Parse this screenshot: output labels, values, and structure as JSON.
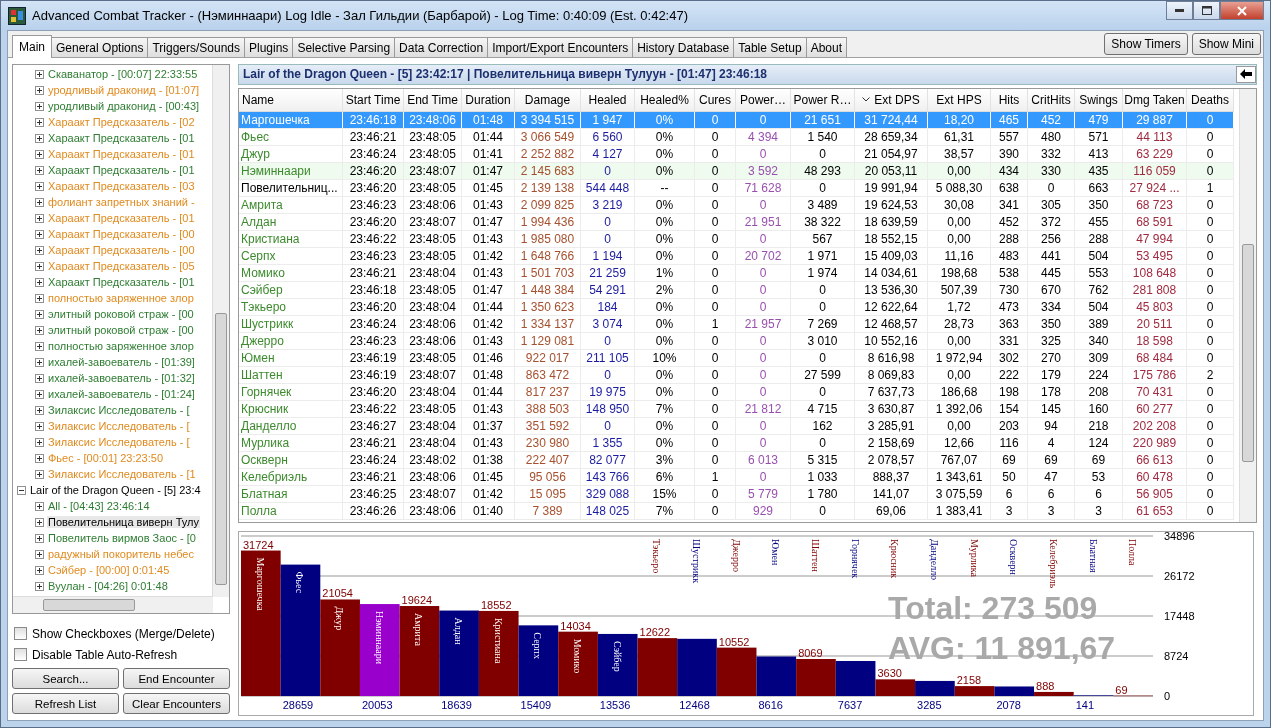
{
  "window": {
    "title": "Advanced Combat Tracker - (Нэминнаари) Log Idle - Зал Гильдии (Барбарой) - Log Time: 0:40:09 (Est. 0:42:47)"
  },
  "tabs": [
    {
      "label": "Main",
      "selected": true
    },
    {
      "label": "General Options",
      "selected": false
    },
    {
      "label": "Triggers/Sounds",
      "selected": false
    },
    {
      "label": "Plugins",
      "selected": false
    },
    {
      "label": "Selective Parsing",
      "selected": false
    },
    {
      "label": "Data Correction",
      "selected": false
    },
    {
      "label": "Import/Export Encounters",
      "selected": false
    },
    {
      "label": "History Database",
      "selected": false
    },
    {
      "label": "Table Setup",
      "selected": false
    },
    {
      "label": "About",
      "selected": false
    }
  ],
  "view_buttons": [
    "Show Timers",
    "Show Mini"
  ],
  "encounter_tree": [
    {
      "children": [
        {
          "label": "Скаванатор - [00:07] 22:33:55",
          "color": "#2e7d32",
          "expanded": false,
          "selected": false
        },
        {
          "label": "уродливый драконид - [01:07]",
          "color": "#e08a1e",
          "expanded": false,
          "selected": false
        },
        {
          "label": "уродливый драконид - [00:43]",
          "color": "#2e7d32",
          "expanded": false,
          "selected": false
        },
        {
          "label": "Хараакт Предсказатель - [02",
          "color": "#e08a1e",
          "expanded": false,
          "selected": false
        },
        {
          "label": "Хараакт Предсказатель - [01",
          "color": "#2e7d32",
          "expanded": false,
          "selected": false
        },
        {
          "label": "Хараакт Предсказатель - [01",
          "color": "#e08a1e",
          "expanded": false,
          "selected": false
        },
        {
          "label": "Хараакт Предсказатель - [01",
          "color": "#2e7d32",
          "expanded": false,
          "selected": false
        },
        {
          "label": "Хараакт Предсказатель - [03",
          "color": "#e08a1e",
          "expanded": false,
          "selected": false
        },
        {
          "label": "фолиант запретных знаний -",
          "color": "#e08a1e",
          "expanded": false,
          "selected": false
        },
        {
          "label": "Хараакт Предсказатель - [01",
          "color": "#e08a1e",
          "expanded": false,
          "selected": false
        },
        {
          "label": "Хараакт Предсказатель - [00",
          "color": "#e08a1e",
          "expanded": false,
          "selected": false
        },
        {
          "label": "Хараакт Предсказатель - [00",
          "color": "#e08a1e",
          "expanded": false,
          "selected": false
        },
        {
          "label": "Хараакт Предсказатель - [05",
          "color": "#e08a1e",
          "expanded": false,
          "selected": false
        },
        {
          "label": "Хараакт Предсказатель - [01",
          "color": "#2e7d32",
          "expanded": false,
          "selected": false
        },
        {
          "label": "полностью заряженное злор",
          "color": "#e08a1e",
          "expanded": false,
          "selected": false
        },
        {
          "label": "элитный роковой страж - [00",
          "color": "#2e7d32",
          "expanded": false,
          "selected": false
        },
        {
          "label": "элитный роковой страж - [00",
          "color": "#2e7d32",
          "expanded": false,
          "selected": false
        },
        {
          "label": "полностью заряженное злор",
          "color": "#2e7d32",
          "expanded": false,
          "selected": false
        },
        {
          "label": "ихалей-завоеватель - [01:39]",
          "color": "#2e7d32",
          "expanded": false,
          "selected": false
        },
        {
          "label": "ихалей-завоеватель - [01:32]",
          "color": "#2e7d32",
          "expanded": false,
          "selected": false
        },
        {
          "label": "ихалей-завоеватель - [01:24]",
          "color": "#2e7d32",
          "expanded": false,
          "selected": false
        },
        {
          "label": "Зилаксис Исследователь - [",
          "color": "#2e7d32",
          "expanded": false,
          "selected": false
        },
        {
          "label": "Зилаксис Исследователь - [",
          "color": "#e08a1e",
          "expanded": false,
          "selected": false
        },
        {
          "label": "Зилаксис Исследователь - [",
          "color": "#e08a1e",
          "expanded": false,
          "selected": false
        },
        {
          "label": "Фьес - [00:01] 23:23:50",
          "color": "#e08a1e",
          "expanded": false,
          "selected": false
        },
        {
          "label": "Зилаксис Исследователь - [1",
          "color": "#e08a1e",
          "expanded": false,
          "selected": false
        }
      ]
    },
    {
      "label": "Lair of the Dragon Queen - [5] 23:4",
      "color": "#000000",
      "expanded": true,
      "selected": false,
      "children": [
        {
          "label": "All - [04:43] 23:46:14",
          "color": "#2e7d32",
          "expanded": false,
          "selected": false
        },
        {
          "label": "Повелительница виверн Тулу",
          "color": "#000000",
          "expanded": false,
          "selected": true
        },
        {
          "label": "Повелитель вирмов Заос - [0",
          "color": "#2e7d32",
          "expanded": false,
          "selected": false
        },
        {
          "label": "радужный покоритель небес",
          "color": "#e08a1e",
          "expanded": false,
          "selected": false
        },
        {
          "label": "Сэйбер - [00:00] 0:01:45",
          "color": "#e08a1e",
          "expanded": false,
          "selected": false
        },
        {
          "label": "Вуулан - [04:26] 0:01:48",
          "color": "#2e7d32",
          "expanded": false,
          "selected": false
        }
      ]
    }
  ],
  "options": [
    {
      "label": "Show Checkboxes (Merge/Delete)",
      "checked": false
    },
    {
      "label": "Disable Table Auto-Refresh",
      "checked": false
    }
  ],
  "actions": [
    "Search...",
    "End Encounter",
    "Refresh List",
    "Clear Encounters"
  ],
  "encounter_header": "Lair of the Dragon Queen - [5] 23:42:17 | Повелительница виверн Тулуун - [01:47] 23:46:18",
  "table": {
    "columns": [
      {
        "label": "Name",
        "sorted": false
      },
      {
        "label": "Start Time",
        "sorted": false
      },
      {
        "label": "End Time",
        "sorted": false
      },
      {
        "label": "Duration",
        "sorted": false
      },
      {
        "label": "Damage",
        "sorted": false
      },
      {
        "label": "Healed",
        "sorted": false
      },
      {
        "label": "Healed%",
        "sorted": false
      },
      {
        "label": "Cures",
        "sorted": false
      },
      {
        "label": "Power…",
        "sorted": false
      },
      {
        "label": "Power R…",
        "sorted": false
      },
      {
        "label": "Ext DPS",
        "sorted": true
      },
      {
        "label": "Ext HPS",
        "sorted": false
      },
      {
        "label": "Hits",
        "sorted": false
      },
      {
        "label": "CritHits",
        "sorted": false
      },
      {
        "label": "Swings",
        "sorted": false
      },
      {
        "label": "Dmg Taken",
        "sorted": false
      },
      {
        "label": "Deaths",
        "sorted": false
      }
    ],
    "rows": [
      {
        "kind": "ally",
        "selected": true,
        "cells": [
          "Маргошечка",
          "23:46:18",
          "23:48:06",
          "01:48",
          "3 394 515",
          "1 947",
          "0%",
          "0",
          "0",
          "21 651",
          "31 724,44",
          "18,20",
          "465",
          "452",
          "479",
          "29 887",
          "0"
        ]
      },
      {
        "kind": "ally",
        "selected": false,
        "cells": [
          "Фьес",
          "23:46:21",
          "23:48:05",
          "01:44",
          "3 066 549",
          "6 560",
          "0%",
          "0",
          "4 394",
          "1 540",
          "28 659,34",
          "61,31",
          "557",
          "480",
          "571",
          "44 113",
          "0"
        ]
      },
      {
        "kind": "ally",
        "selected": false,
        "cells": [
          "Джур",
          "23:46:24",
          "23:48:05",
          "01:41",
          "2 252 882",
          "4 127",
          "0%",
          "0",
          "0",
          "0",
          "21 054,97",
          "38,57",
          "390",
          "332",
          "413",
          "63 229",
          "0"
        ]
      },
      {
        "kind": "self",
        "selected": false,
        "cells": [
          "Нэминнаари",
          "23:46:20",
          "23:48:07",
          "01:47",
          "2 145 683",
          "0",
          "0%",
          "0",
          "3 592",
          "48 293",
          "20 053,11",
          "0,00",
          "434",
          "330",
          "435",
          "116 059",
          "0"
        ]
      },
      {
        "kind": "enemy",
        "selected": false,
        "cells": [
          "Повелительниц...",
          "23:46:20",
          "23:48:05",
          "01:45",
          "2 139 138",
          "544 448",
          "--",
          "0",
          "71 628",
          "0",
          "19 991,94",
          "5 088,30",
          "638",
          "0",
          "663",
          "27 924 ...",
          "1"
        ]
      },
      {
        "kind": "ally",
        "selected": false,
        "cells": [
          "Амрита",
          "23:46:23",
          "23:48:06",
          "01:43",
          "2 099 825",
          "3 219",
          "0%",
          "0",
          "0",
          "3 489",
          "19 624,53",
          "30,08",
          "341",
          "305",
          "350",
          "68 723",
          "0"
        ]
      },
      {
        "kind": "ally",
        "selected": false,
        "cells": [
          "Алдан",
          "23:46:20",
          "23:48:07",
          "01:47",
          "1 994 436",
          "0",
          "0%",
          "0",
          "21 951",
          "38 322",
          "18 639,59",
          "0,00",
          "452",
          "372",
          "455",
          "68 591",
          "0"
        ]
      },
      {
        "kind": "ally",
        "selected": false,
        "cells": [
          "Кристиана",
          "23:46:22",
          "23:48:05",
          "01:43",
          "1 985 080",
          "0",
          "0%",
          "0",
          "0",
          "567",
          "18 552,15",
          "0,00",
          "288",
          "256",
          "288",
          "47 994",
          "0"
        ]
      },
      {
        "kind": "ally",
        "selected": false,
        "cells": [
          "Серпх",
          "23:46:23",
          "23:48:05",
          "01:42",
          "1 648 766",
          "1 194",
          "0%",
          "0",
          "20 702",
          "1 971",
          "15 409,03",
          "11,16",
          "483",
          "441",
          "504",
          "53 495",
          "0"
        ]
      },
      {
        "kind": "ally",
        "selected": false,
        "cells": [
          "Момико",
          "23:46:21",
          "23:48:04",
          "01:43",
          "1 501 703",
          "21 259",
          "1%",
          "0",
          "0",
          "1 974",
          "14 034,61",
          "198,68",
          "538",
          "445",
          "553",
          "108 648",
          "0"
        ]
      },
      {
        "kind": "ally",
        "selected": false,
        "cells": [
          "Сэйбер",
          "23:46:18",
          "23:48:05",
          "01:47",
          "1 448 384",
          "54 291",
          "2%",
          "0",
          "0",
          "0",
          "13 536,30",
          "507,39",
          "730",
          "670",
          "762",
          "281 808",
          "0"
        ]
      },
      {
        "kind": "ally",
        "selected": false,
        "cells": [
          "Тэкьеро",
          "23:46:20",
          "23:48:04",
          "01:44",
          "1 350 623",
          "184",
          "0%",
          "0",
          "0",
          "0",
          "12 622,64",
          "1,72",
          "473",
          "334",
          "504",
          "45 803",
          "0"
        ]
      },
      {
        "kind": "ally",
        "selected": false,
        "cells": [
          "Шустрикк",
          "23:46:24",
          "23:48:06",
          "01:42",
          "1 334 137",
          "3 074",
          "0%",
          "1",
          "21 957",
          "7 269",
          "12 468,57",
          "28,73",
          "363",
          "350",
          "389",
          "20 511",
          "0"
        ]
      },
      {
        "kind": "ally",
        "selected": false,
        "cells": [
          "Джерро",
          "23:46:23",
          "23:48:06",
          "01:43",
          "1 129 081",
          "0",
          "0%",
          "0",
          "0",
          "3 010",
          "10 552,16",
          "0,00",
          "331",
          "325",
          "340",
          "18 598",
          "0"
        ]
      },
      {
        "kind": "ally",
        "selected": false,
        "cells": [
          "Юмен",
          "23:46:19",
          "23:48:05",
          "01:46",
          "922 017",
          "211 105",
          "10%",
          "0",
          "0",
          "0",
          "8 616,98",
          "1 972,94",
          "302",
          "270",
          "309",
          "68 484",
          "0"
        ]
      },
      {
        "kind": "ally",
        "selected": false,
        "cells": [
          "Шаттен",
          "23:46:19",
          "23:48:07",
          "01:48",
          "863 472",
          "0",
          "0%",
          "0",
          "0",
          "27 599",
          "8 069,83",
          "0,00",
          "222",
          "179",
          "224",
          "175 786",
          "2"
        ]
      },
      {
        "kind": "ally",
        "selected": false,
        "cells": [
          "Горнячек",
          "23:46:20",
          "23:48:04",
          "01:44",
          "817 237",
          "19 975",
          "0%",
          "0",
          "0",
          "0",
          "7 637,73",
          "186,68",
          "198",
          "178",
          "208",
          "70 431",
          "0"
        ]
      },
      {
        "kind": "ally",
        "selected": false,
        "cells": [
          "Крюсник",
          "23:46:22",
          "23:48:05",
          "01:43",
          "388 503",
          "148 950",
          "7%",
          "0",
          "21 812",
          "4 715",
          "3 630,87",
          "1 392,06",
          "154",
          "145",
          "160",
          "60 277",
          "0"
        ]
      },
      {
        "kind": "ally",
        "selected": false,
        "cells": [
          "Данделло",
          "23:46:27",
          "23:48:04",
          "01:37",
          "351 592",
          "0",
          "0%",
          "0",
          "0",
          "162",
          "3 285,91",
          "0,00",
          "203",
          "94",
          "218",
          "202 208",
          "0"
        ]
      },
      {
        "kind": "ally",
        "selected": false,
        "cells": [
          "Мурлика",
          "23:46:21",
          "23:48:04",
          "01:43",
          "230 980",
          "1 355",
          "0%",
          "0",
          "0",
          "0",
          "2 158,69",
          "12,66",
          "116",
          "4",
          "124",
          "220 989",
          "0"
        ]
      },
      {
        "kind": "ally",
        "selected": false,
        "cells": [
          "Оскверн",
          "23:46:24",
          "23:48:02",
          "01:38",
          "222 407",
          "82 077",
          "3%",
          "0",
          "6 013",
          "5 315",
          "2 078,57",
          "767,07",
          "69",
          "69",
          "69",
          "66 613",
          "0"
        ]
      },
      {
        "kind": "ally",
        "selected": false,
        "cells": [
          "Келебриэль",
          "23:46:21",
          "23:48:06",
          "01:45",
          "95 056",
          "143 766",
          "6%",
          "1",
          "0",
          "1 033",
          "888,37",
          "1 343,61",
          "50",
          "47",
          "53",
          "60 478",
          "0"
        ]
      },
      {
        "kind": "ally",
        "selected": false,
        "cells": [
          "Блатная",
          "23:46:25",
          "23:48:07",
          "01:42",
          "15 095",
          "329 088",
          "15%",
          "0",
          "5 779",
          "1 780",
          "141,07",
          "3 075,59",
          "6",
          "6",
          "6",
          "56 905",
          "0"
        ]
      },
      {
        "kind": "ally",
        "selected": false,
        "cells": [
          "Полла",
          "23:46:26",
          "23:48:06",
          "01:40",
          "7 389",
          "148 025",
          "7%",
          "0",
          "929",
          "0",
          "69,06",
          "1 383,41",
          "3",
          "3",
          "3",
          "61 653",
          "0"
        ]
      }
    ]
  },
  "graph": {
    "total": "Total: 273 509",
    "avg": "AVG: 11 891,67",
    "chart_data": {
      "type": "bar",
      "categories": [
        "Маргошечка",
        "Фьес",
        "Джур",
        "Нэминнаари",
        "Амрита",
        "Алдан",
        "Кристиана",
        "Серпх",
        "Момико",
        "Сэйбер",
        "Тэкьеро",
        "Шустрикк",
        "Джерро",
        "Юмен",
        "Шаттен",
        "Горнячек",
        "Крюсник",
        "Данделло",
        "Мурлика",
        "Оскверн",
        "Келебриэль",
        "Блатная",
        "Полла"
      ],
      "series": [
        {
          "color": "#800000",
          "values": [
            31724,
            null,
            21054,
            null,
            19624,
            null,
            18552,
            null,
            14034,
            null,
            12622,
            null,
            10552,
            null,
            8069,
            null,
            3630,
            null,
            2158,
            null,
            888,
            null,
            69
          ]
        },
        {
          "color": "#000080",
          "values": [
            null,
            28659,
            null,
            null,
            null,
            18639,
            null,
            15409,
            null,
            13536,
            null,
            12468,
            null,
            8616,
            null,
            7637,
            null,
            3285,
            null,
            2078,
            null,
            141,
            null
          ]
        },
        {
          "color": "#9900cc",
          "values": [
            null,
            null,
            null,
            20053,
            null,
            null,
            null,
            null,
            null,
            null,
            null,
            null,
            null,
            null,
            null,
            null,
            null,
            null,
            null,
            null,
            null,
            null,
            null
          ]
        }
      ],
      "ylim": [
        0,
        34896
      ],
      "yticks": [
        0,
        8724,
        17448,
        26172,
        34896
      ],
      "grid": true,
      "data_labels": true
    }
  }
}
